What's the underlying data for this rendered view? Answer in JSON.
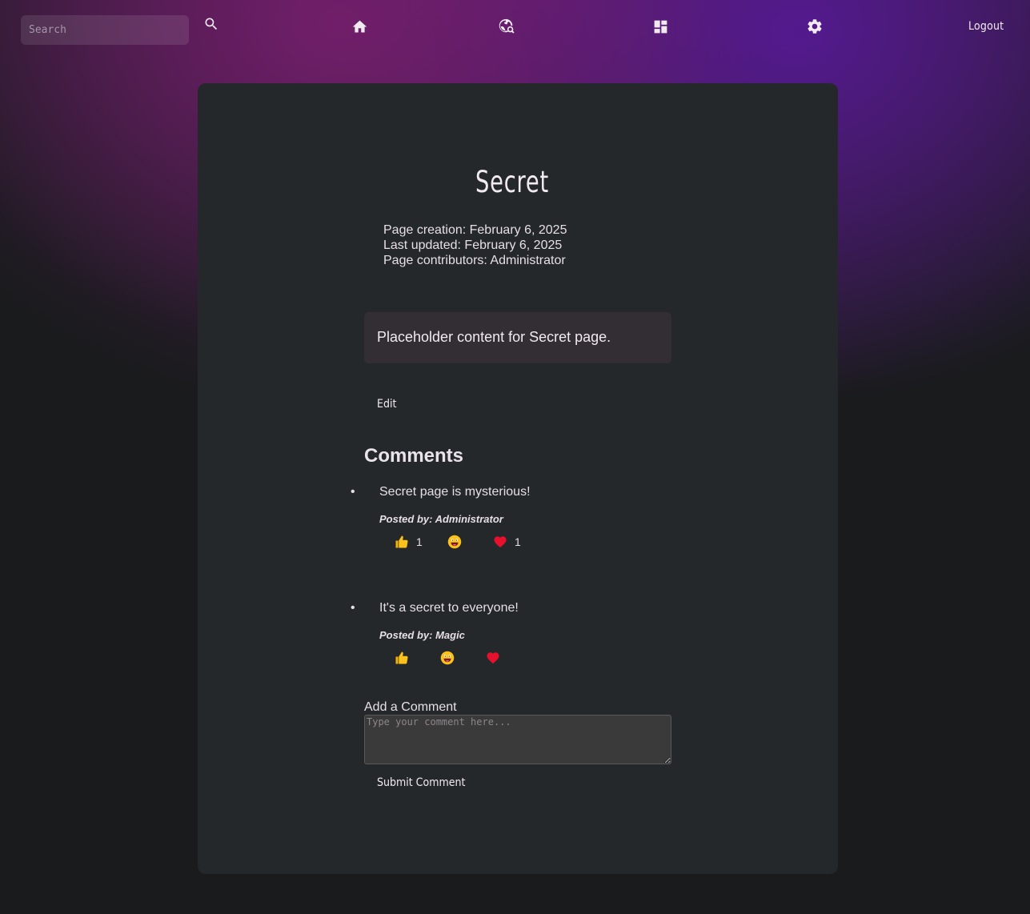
{
  "nav": {
    "search_placeholder": "Search",
    "icons": [
      "search-icon",
      "home-icon",
      "explore-icon",
      "dashboard-icon",
      "settings-icon"
    ],
    "logout_label": "Logout"
  },
  "page": {
    "title": "Secret",
    "creation": "Page creation: February 6, 2025",
    "updated": "Last updated: February 6, 2025",
    "contributors": "Page contributors: Administrator",
    "content": "Placeholder content for Secret page.",
    "edit_label": "Edit"
  },
  "comments": {
    "heading": "Comments",
    "items": [
      {
        "text": "Secret page is mysterious!",
        "author": "Posted by: Administrator",
        "reactions": [
          {
            "icon": "thumbs-up-icon",
            "count": "1"
          },
          {
            "icon": "laughing-face-icon",
            "count": ""
          },
          {
            "icon": "heart-icon",
            "count": "1"
          }
        ]
      },
      {
        "text": "It's a secret to everyone!",
        "author": "Posted by: Magic",
        "reactions": [
          {
            "icon": "thumbs-up-icon",
            "count": ""
          },
          {
            "icon": "laughing-face-icon",
            "count": ""
          },
          {
            "icon": "heart-icon",
            "count": ""
          }
        ]
      }
    ]
  },
  "add_comment": {
    "label": "Add a Comment",
    "placeholder": "Type your comment here...",
    "submit_label": "Submit Comment"
  },
  "colors": {
    "card_background": "#25282b",
    "content_box": "#332e33",
    "text": "#e6dfe6"
  }
}
